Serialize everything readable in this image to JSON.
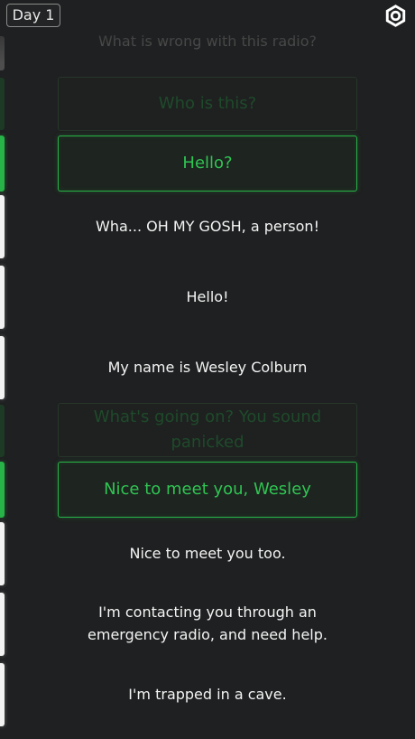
{
  "header": {
    "day_label": "Day 1"
  },
  "conversation": {
    "faded_top_line": "What is wrong with this radio?",
    "choice_1_unselected": "Who is this?",
    "choice_1_selected": "Hello?",
    "reply_1": "Wha... OH MY GOSH, a person!",
    "reply_2": "Hello!",
    "reply_3": "My name is Wesley Colburn",
    "choice_2_unselected": "What's going on? You sound panicked",
    "choice_2_selected": "Nice to meet you, Wesley",
    "reply_4": "Nice to meet you too.",
    "reply_5_line_1": "I'm contacting you through an",
    "reply_5_line_2": "emergency radio, and need help.",
    "reply_6": "I'm trapped in a cave."
  },
  "colors": {
    "background": "#1f2021",
    "accent_green": "#27b347",
    "text": "#f4f4f4"
  },
  "icons": {
    "settings": "gear-icon"
  }
}
